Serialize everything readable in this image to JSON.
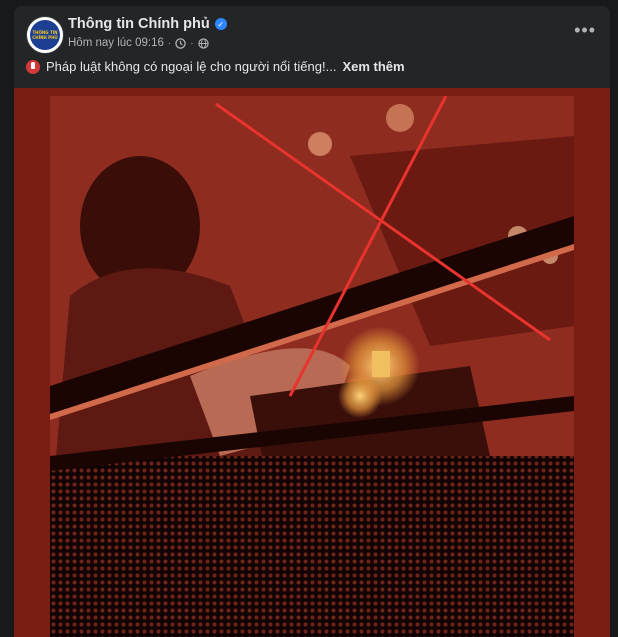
{
  "post": {
    "page_name": "Thông tin Chính phủ",
    "timestamp": "Hôm nay lúc 09:16",
    "caption": "Pháp luật không có ngoại lệ cho người nổi tiếng!...",
    "see_more": "Xem thêm",
    "avatar_text": [
      "THÔNG TIN",
      "CHÍNH PHỦ"
    ]
  },
  "icons": {
    "verified": "verified-badge-icon",
    "clock": "clock-icon",
    "audience": "globe-icon",
    "more": "more-options-icon",
    "caption_emoji": "warning-emoji-icon"
  },
  "colors": {
    "background": "#18191a",
    "card": "#242526",
    "text_primary": "#e4e6eb",
    "text_secondary": "#b0b3b8",
    "verified": "#2d88ff",
    "cross_mark": "#e8332e"
  }
}
